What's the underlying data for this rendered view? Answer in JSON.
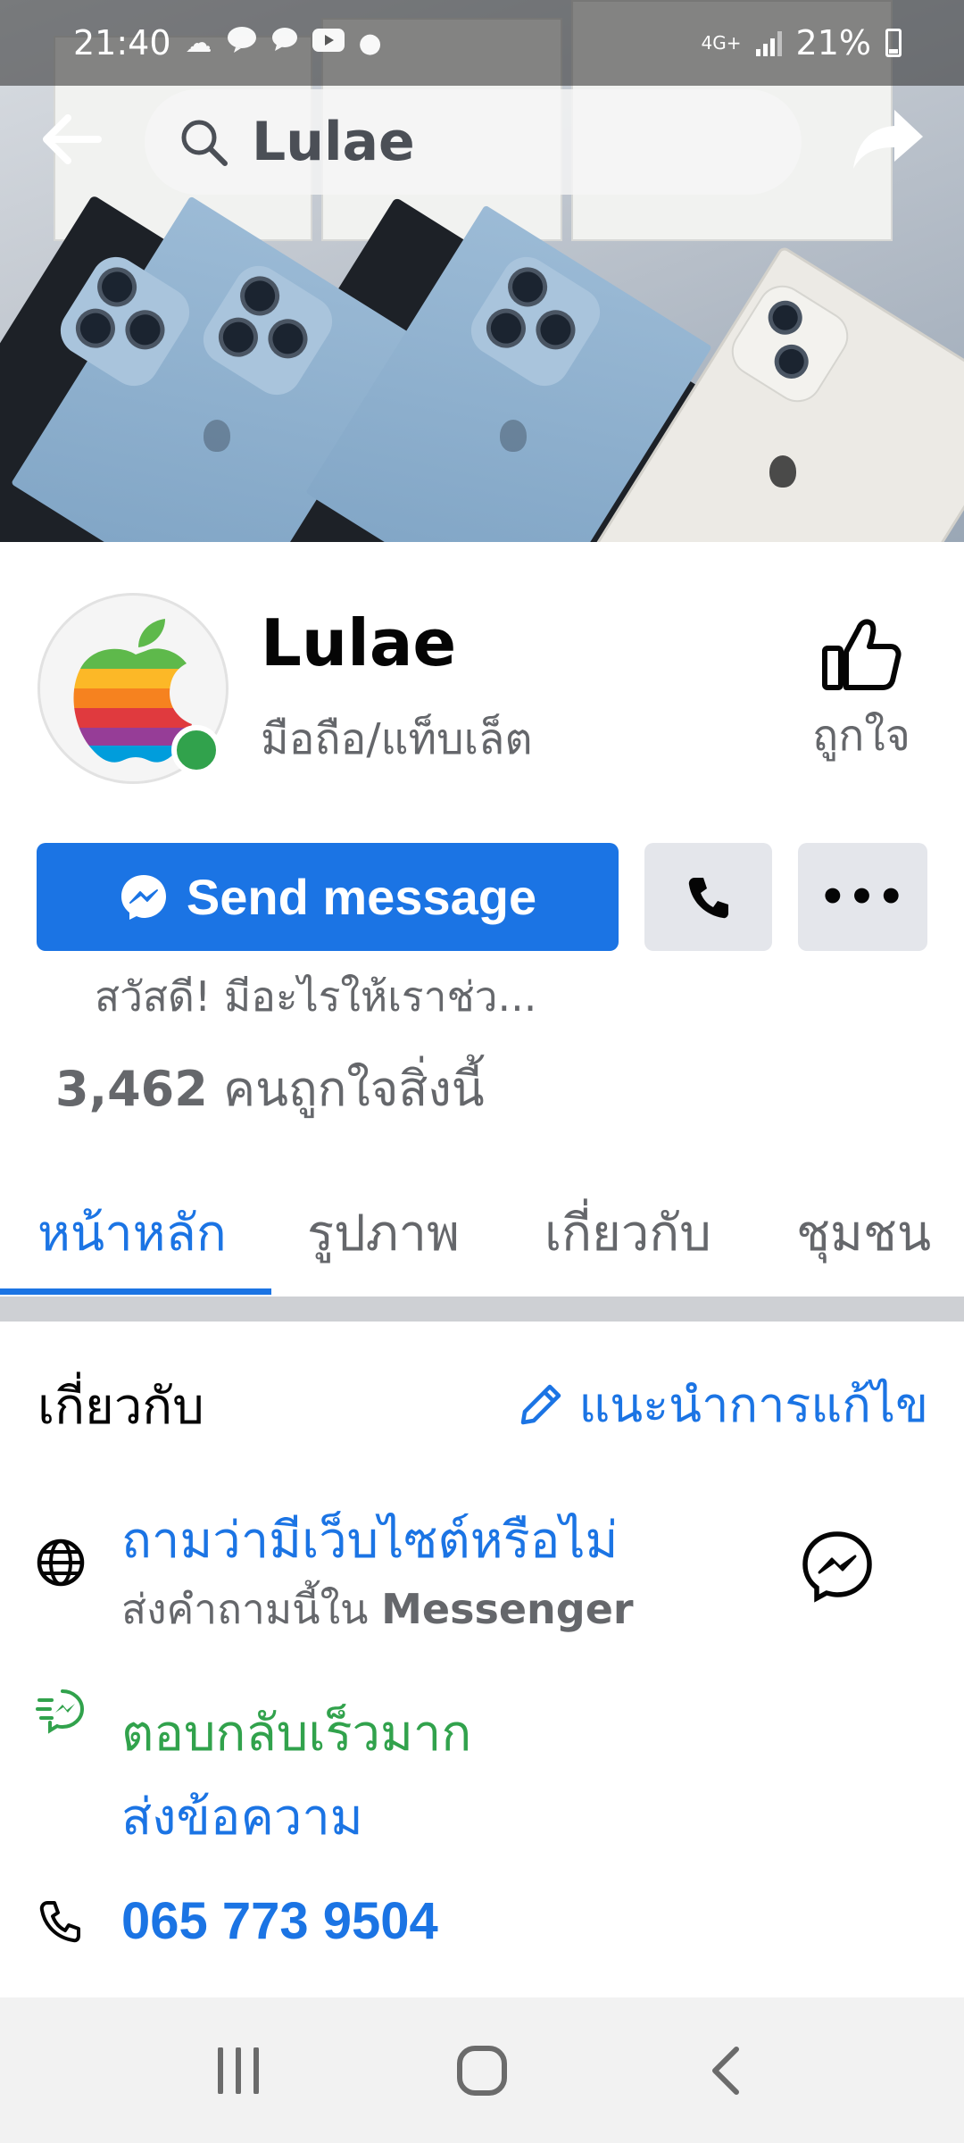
{
  "status_bar": {
    "time": "21:40",
    "network": "4G+",
    "battery": "21%"
  },
  "top_nav": {
    "search_text": "Lulae"
  },
  "profile": {
    "name": "Lulae",
    "category": "มือถือ/แท็บเล็ต",
    "like_label": "ถูกใจ"
  },
  "actions": {
    "send_message_label": "Send message",
    "more_label": "•••"
  },
  "greeting": "สวัสดี! มีอะไรให้เราช่ว...",
  "likes": {
    "count": "3,462",
    "suffix": " คนถูกใจสิ่งนี้"
  },
  "tabs": [
    {
      "label": "หน้าหลัก",
      "active": true
    },
    {
      "label": "รูปภาพ",
      "active": false
    },
    {
      "label": "เกี่ยวกับ",
      "active": false
    },
    {
      "label": "ชุมชน",
      "active": false
    }
  ],
  "about": {
    "title": "เกี่ยวกับ",
    "suggest_edit": "แนะนำการแก้ไข",
    "website_title": "ถามว่ามีเว็บไซต์หรือไม่",
    "website_sub_prefix": "ส่งคำถามนี้ใน ",
    "website_sub_bold": "Messenger",
    "responsive_title": "ตอบกลับเร็วมาก",
    "send_message_link": "ส่งข้อความ",
    "phone": "065 773 9504"
  },
  "colors": {
    "accent": "#1b74e4",
    "green": "#31a24c",
    "secondary_text": "#65676b",
    "button_gray": "#e4e6eb"
  }
}
